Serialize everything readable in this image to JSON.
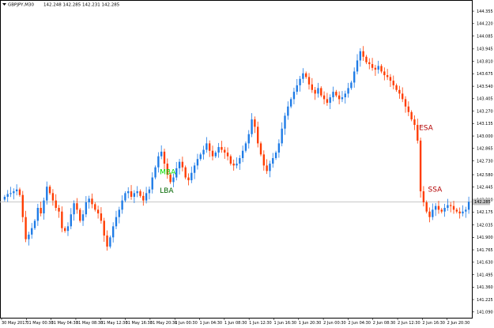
{
  "header": {
    "symbol_info": "GBPJPY,M30",
    "ohlc": "142.248 142.285 142.231 142.285"
  },
  "chart_data": {
    "type": "candlestick",
    "symbol": "GBPJPY",
    "timeframe": "M30",
    "current_price": "142.285",
    "price_axis": {
      "min": 141.045,
      "max": 144.39,
      "ticks": [
        "144.355",
        "144.220",
        "144.085",
        "143.945",
        "143.810",
        "143.675",
        "143.540",
        "143.405",
        "143.270",
        "143.135",
        "143.000",
        "142.865",
        "142.730",
        "142.580",
        "142.445",
        "142.310",
        "142.175",
        "142.035",
        "141.900",
        "141.765",
        "141.630",
        "141.495",
        "141.360",
        "141.225",
        "141.090"
      ]
    },
    "time_axis": {
      "ticks": [
        "30 May 2017",
        "31 May 00:30",
        "31 May 04:30",
        "31 May 08:30",
        "31 May 12:30",
        "31 May 16:30",
        "31 May 20:30",
        "1 Jun 00:30",
        "1 Jun 04:30",
        "1 Jun 08:30",
        "1 Jun 12:30",
        "1 Jun 16:30",
        "1 Jun 20:30",
        "2 Jun 00:30",
        "2 Jun 04:30",
        "2 Jun 08:30",
        "2 Jun 12:30",
        "2 Jun 16:30",
        "2 Jun 20:30"
      ]
    },
    "candle_closes": [
      142.34,
      142.37,
      142.38,
      142.4,
      142.42,
      142.36,
      142.12,
      141.88,
      141.93,
      142.0,
      142.08,
      142.22,
      142.16,
      142.3,
      142.45,
      142.38,
      142.3,
      142.22,
      142.18,
      142.0,
      141.97,
      142.02,
      142.15,
      142.27,
      142.2,
      142.08,
      142.15,
      142.28,
      142.32,
      142.26,
      142.2,
      142.16,
      142.08,
      141.92,
      141.8,
      141.9,
      142.02,
      142.12,
      142.2,
      142.3,
      142.38,
      142.4,
      142.34,
      142.38,
      142.4,
      142.35,
      142.3,
      142.38,
      142.42,
      142.55,
      142.66,
      142.78,
      142.83,
      142.7,
      142.58,
      142.5,
      142.55,
      142.65,
      142.72,
      142.66,
      142.55,
      142.52,
      142.6,
      142.68,
      142.75,
      142.8,
      142.85,
      142.92,
      142.84,
      142.78,
      142.82,
      142.88,
      142.85,
      142.82,
      142.78,
      142.7,
      142.68,
      142.7,
      142.76,
      142.84,
      142.92,
      143.02,
      143.18,
      143.1,
      142.92,
      142.8,
      142.68,
      142.62,
      142.7,
      142.76,
      142.82,
      142.92,
      143.08,
      143.22,
      143.32,
      143.4,
      143.48,
      143.55,
      143.62,
      143.68,
      143.64,
      143.56,
      143.5,
      143.46,
      143.52,
      143.44,
      143.4,
      143.36,
      143.42,
      143.48,
      143.44,
      143.4,
      143.42,
      143.46,
      143.52,
      143.58,
      143.7,
      143.82,
      143.92,
      143.86,
      143.8,
      143.78,
      143.74,
      143.72,
      143.76,
      143.7,
      143.66,
      143.64,
      143.6,
      143.55,
      143.5,
      143.46,
      143.4,
      143.32,
      143.26,
      143.18,
      143.12,
      142.95,
      142.4,
      142.28,
      142.18,
      142.12,
      142.2,
      142.24,
      142.2,
      142.18,
      142.22,
      142.25,
      142.24,
      142.2,
      142.18,
      142.16,
      142.18,
      142.2,
      142.285
    ],
    "signals": [
      {
        "label": "MBA",
        "color": "#00dd00",
        "index": 52,
        "price": 142.61
      },
      {
        "label": "LBA",
        "color": "#006600",
        "index": 52,
        "price": 142.41
      },
      {
        "label": "ESA",
        "color": "#b30000",
        "index": 138,
        "price": 143.09
      },
      {
        "label": "SSA",
        "color": "#b30000",
        "index": 141,
        "price": 142.42
      }
    ],
    "colors": {
      "bull": "#1e7be6",
      "bear": "#ff3c00",
      "price_line": "#c0c0c0",
      "price_label_bg": "#c0c0c0"
    }
  }
}
